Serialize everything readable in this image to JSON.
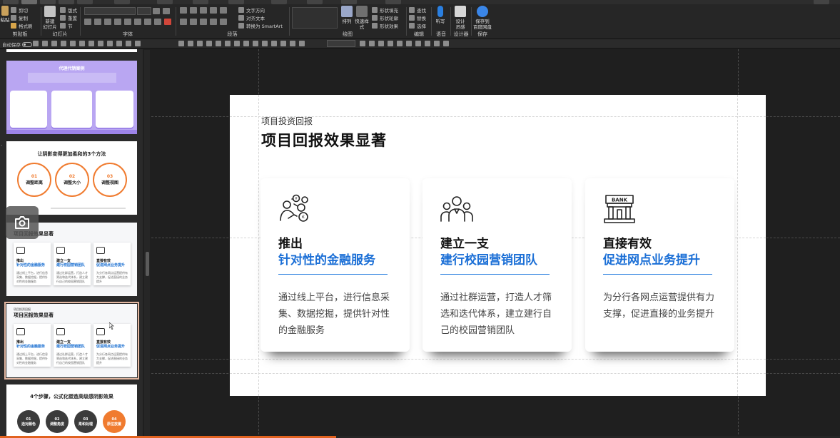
{
  "ribbon": {
    "clipboard_label": "剪贴板",
    "slides_label": "幻灯片",
    "font_label": "字体",
    "paragraph_label": "段落",
    "drawing_label": "绘图",
    "editing_label": "编辑",
    "voice_label": "语音",
    "designer_label": "设计器",
    "save_label": "保存",
    "paste": "粘贴",
    "cut": "剪切",
    "copy": "复制",
    "format_painter": "格式刷",
    "new_slide": "新建\n幻灯片",
    "layout": "版式",
    "reset": "重置",
    "section": "节",
    "text_direction": "文字方向",
    "align_text": "对齐文本",
    "smartart": "转换为 SmartArt",
    "arrange": "排列",
    "quick_styles": "快速样式",
    "shape_fill": "形状填充",
    "shape_outline": "形状轮廓",
    "shape_effects": "形状效果",
    "find": "查找",
    "replace": "替换",
    "select": "选择",
    "dictate": "听写",
    "design_ideas": "设计\n灵感",
    "save_to_baidu": "保存到\n百度网盘"
  },
  "qat": {
    "autosave": "自动保存"
  },
  "thumbnails": {
    "t1_title": "代理代销案例",
    "t2_title": "让阴影变得更加柔和的3个方法",
    "t2_items": [
      {
        "n": "01",
        "l": "调整距离"
      },
      {
        "n": "02",
        "l": "调整大小"
      },
      {
        "n": "03",
        "l": "调整视图"
      }
    ],
    "t3_title": "项目回报效果显著",
    "t4_kicker": "项目投资回报",
    "t4_title": "项目回报效果显著",
    "mini_cards": [
      {
        "a": "推出",
        "b": "针对性的金融服务",
        "c": "通过线上平台，进行信息采集、数据挖掘，提供针对性的金融服务"
      },
      {
        "a": "建立一支",
        "b": "建行校园营销团队",
        "c": "通过社群运营，打造人才筛选和迭代体系，建立建行自己的校园营销团队"
      },
      {
        "a": "直接有效",
        "b": "促进网点业务提升",
        "c": "为分行各网点运营提供有力支撑，促进直接的业务提升"
      }
    ],
    "t5_title": "4个步骤，公式化塑造高级感阴影效果",
    "t5_items": [
      {
        "n": "01",
        "l": "选对颜色"
      },
      {
        "n": "02",
        "l": "调整角度"
      },
      {
        "n": "03",
        "l": "柔和处理"
      },
      {
        "n": "04",
        "l": "原位放置"
      }
    ]
  },
  "slide": {
    "kicker": "项目投资回报",
    "title": "项目回报效果显著",
    "cards": [
      {
        "title": "推出",
        "subtitle": "针对性的金融服务",
        "body": "通过线上平台，进行信息采集、数据挖掘，提供针对性的金融服务",
        "icon": "finance-person-icon"
      },
      {
        "title": "建立一支",
        "subtitle": "建行校园营销团队",
        "body": "通过社群运营，打造人才筛选和迭代体系，建立建行自己的校园营销团队",
        "icon": "team-icon"
      },
      {
        "title": "直接有效",
        "subtitle": "促进网点业务提升",
        "body": "为分行各网点运营提供有力支撑，促进直接的业务提升",
        "icon": "bank-icon",
        "icon_text": "BANK"
      }
    ]
  },
  "progress": {
    "fraction": 0.4
  },
  "colors": {
    "accent_blue": "#1b6fd6",
    "accent_orange": "#f07b2f",
    "purple": "#b9a6f2"
  }
}
